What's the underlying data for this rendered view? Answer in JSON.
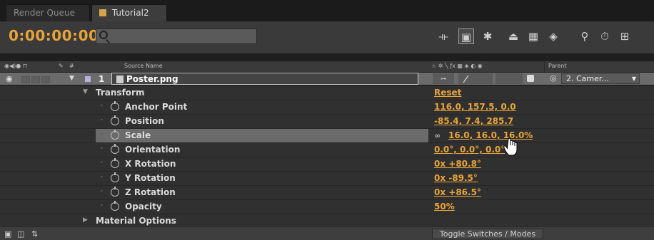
{
  "tabs": [
    {
      "label": "Render Queue"
    },
    {
      "label": "Tutorial2"
    }
  ],
  "toolbar": {
    "timecode": "0:00:00:00",
    "search_value": ""
  },
  "header": {
    "source_name": "Source Name",
    "parent": "Parent",
    "number": "#"
  },
  "layer": {
    "number": "1",
    "name": "Poster.png",
    "parent_value": "2. Camer..."
  },
  "properties": [
    {
      "label": "Transform",
      "value": "Reset"
    },
    {
      "label": "Anchor Point",
      "value": "116.0, 157.5, 0.0"
    },
    {
      "label": "Position",
      "value": "-85.4, 7.4, 285.7"
    },
    {
      "label": "Scale",
      "value": "16.0, 16.0, 16.0%"
    },
    {
      "label": "Orientation",
      "value": "0.0°, 0.0°, 0.0°"
    },
    {
      "label": "X Rotation",
      "value": "0x +80.8°"
    },
    {
      "label": "Y Rotation",
      "value": "0x -89.5°"
    },
    {
      "label": "Z Rotation",
      "value": "0x +86.5°"
    },
    {
      "label": "Opacity",
      "value": "50%"
    },
    {
      "label": "Material Options",
      "value": ""
    }
  ],
  "footer": {
    "toggle_label": "Toggle Switches / Modes"
  },
  "colors": {
    "accent": "#e8a43a",
    "layer_label": "#b6b2e0"
  }
}
